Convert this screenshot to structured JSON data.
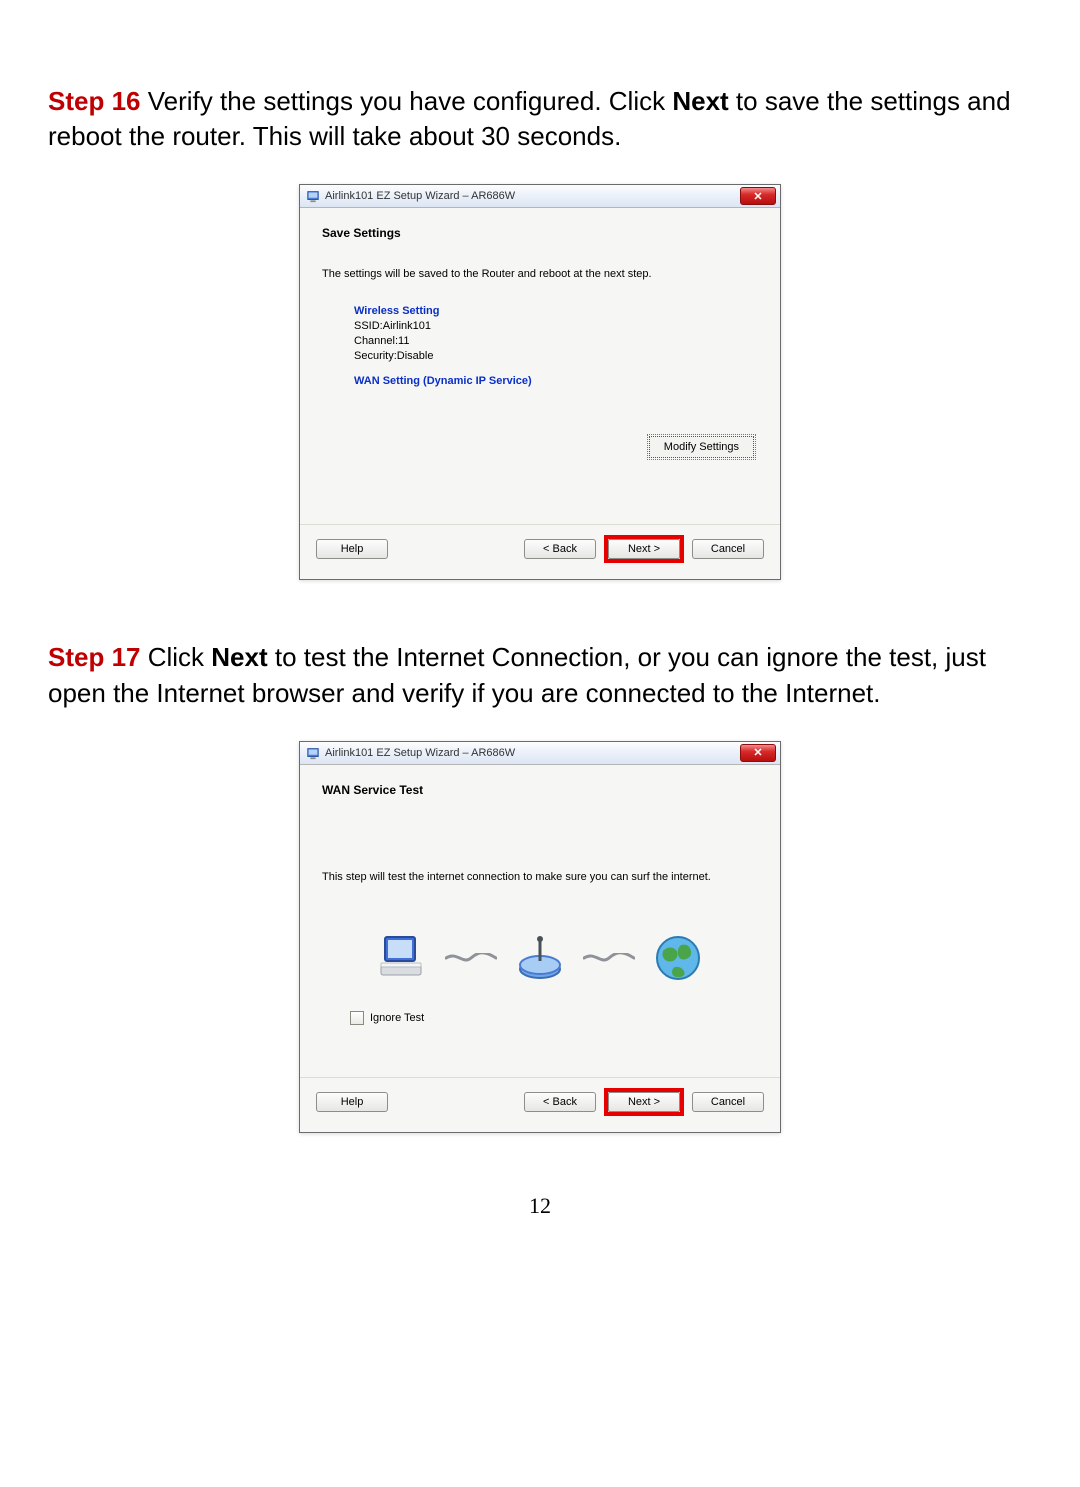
{
  "step16": {
    "label": "Step 16",
    "text_before_next": " Verify the settings you have configured. Click ",
    "next_word": "Next",
    "text_after_next": " to save the settings and reboot the router. This will take about 30 seconds."
  },
  "dialog1": {
    "title": "Airlink101 EZ Setup Wizard – AR686W",
    "heading": "Save Settings",
    "subtext": "The settings will be saved to the Router and reboot at the next step.",
    "wireless_heading": "Wireless Setting",
    "ssid": "SSID:Airlink101",
    "channel": "Channel:11",
    "security": "Security:Disable",
    "wan_heading": "WAN Setting  (Dynamic IP Service)",
    "modify": "Modify Settings",
    "help": "Help",
    "back": "< Back",
    "next": "Next >",
    "cancel": "Cancel"
  },
  "step17": {
    "label": "Step 17",
    "text_before_next": " Click ",
    "next_word": "Next",
    "text_after_next": " to test the Internet Connection, or you can ignore the test, just open the Internet browser and verify if you are connected to the Internet."
  },
  "dialog2": {
    "title": "Airlink101 EZ Setup Wizard – AR686W",
    "heading": "WAN Service Test",
    "subtext": "This step will test the internet connection to make sure you can surf the internet.",
    "ignore": "Ignore Test",
    "help": "Help",
    "back": "< Back",
    "next": "Next >",
    "cancel": "Cancel"
  },
  "page_number": "12"
}
